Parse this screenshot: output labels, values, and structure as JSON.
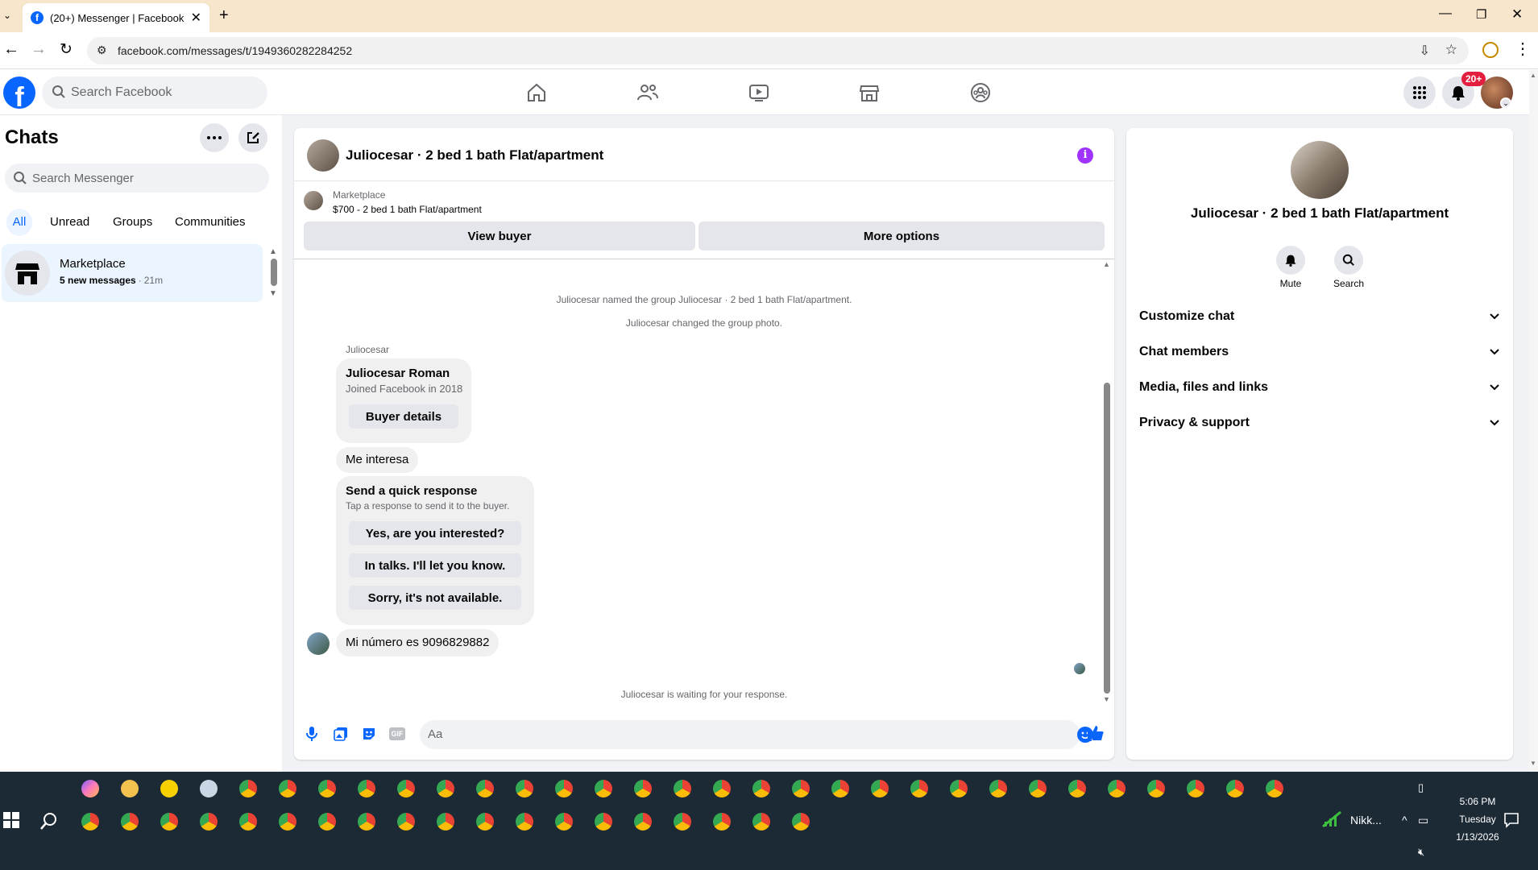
{
  "browser": {
    "tab_title": "(20+) Messenger | Facebook",
    "url": "facebook.com/messages/t/1949360282284252"
  },
  "header": {
    "search_placeholder": "Search Facebook",
    "notification_badge": "20+"
  },
  "sidebar": {
    "title": "Chats",
    "search_placeholder": "Search Messenger",
    "filters": [
      "All",
      "Unread",
      "Groups",
      "Communities"
    ],
    "active_filter": "All",
    "chats": [
      {
        "name": "Marketplace",
        "preview": "5 new messages",
        "time": "21m"
      }
    ]
  },
  "chat": {
    "title": "Juliocesar · 2 bed 1 bath Flat/apartment",
    "listing": {
      "source": "Marketplace",
      "summary": "$700 - 2 bed 1 bath Flat/apartment",
      "view_buyer": "View buyer",
      "more_options": "More options"
    },
    "system_messages": [
      "Juliocesar named the group Juliocesar · 2 bed 1 bath Flat/apartment.",
      "Juliocesar changed the group photo."
    ],
    "sender_name": "Juliocesar",
    "buyer_card": {
      "name": "Juliocesar Roman",
      "joined": "Joined Facebook in 2018",
      "button": "Buyer details"
    },
    "message_1": "Me interesa",
    "quick_response": {
      "title": "Send a quick response",
      "subtitle": "Tap a response to send it to the buyer.",
      "options": [
        "Yes, are you interested?",
        "In talks. I'll let you know.",
        "Sorry, it's not available."
      ]
    },
    "message_2": "Mi número es 9096829882",
    "waiting": "Juliocesar is waiting for your response.",
    "composer_placeholder": "Aa"
  },
  "info": {
    "title": "Juliocesar · 2 bed 1 bath Flat/apartment",
    "actions": [
      "Mute",
      "Search"
    ],
    "sections": [
      "Customize chat",
      "Chat members",
      "Media, files and links",
      "Privacy & support"
    ]
  },
  "taskbar": {
    "time": "5:06 PM",
    "day": "Tuesday",
    "date": "1/13/2026",
    "network_label": "Nikk..."
  },
  "colors": {
    "brand": "#0866ff",
    "messenger_accent": "#a033ff",
    "tab_bar": "#f7e5cc"
  }
}
